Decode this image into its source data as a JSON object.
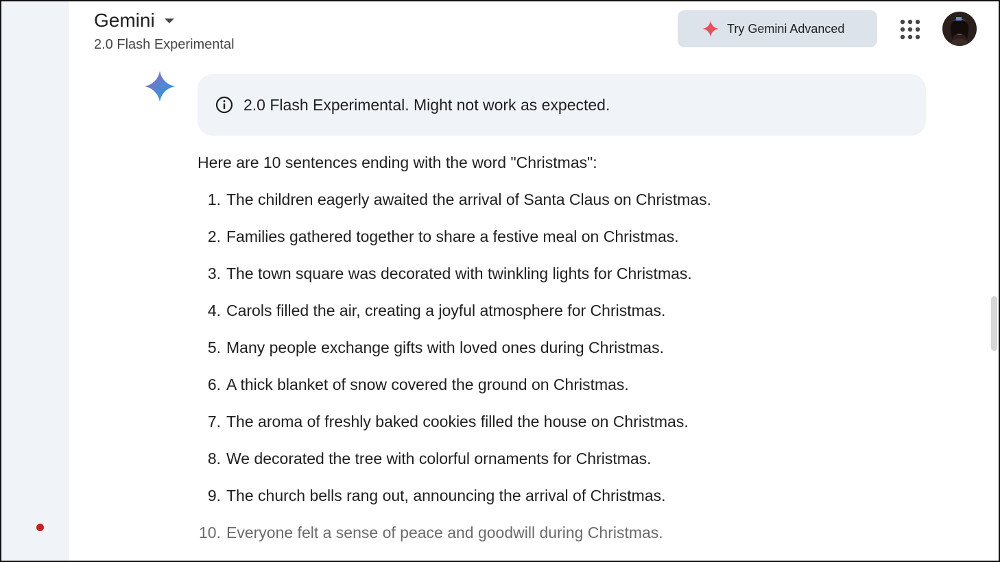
{
  "header": {
    "app_name": "Gemini",
    "model": "2.0 Flash Experimental",
    "advanced_button": "Try Gemini Advanced"
  },
  "notice": {
    "text": "2.0 Flash Experimental. Might not work as expected."
  },
  "response": {
    "intro": "Here are 10 sentences ending with the word \"Christmas\":",
    "items": [
      {
        "num": "1.",
        "text": "The children eagerly awaited the arrival of Santa Claus on Christmas."
      },
      {
        "num": "2.",
        "text": "Families gathered together to share a festive meal on Christmas."
      },
      {
        "num": "3.",
        "text": "The town square was decorated with twinkling lights for Christmas."
      },
      {
        "num": "4.",
        "text": "Carols filled the air, creating a joyful atmosphere for Christmas."
      },
      {
        "num": "5.",
        "text": "Many people exchange gifts with loved ones during Christmas."
      },
      {
        "num": "6.",
        "text": "A thick blanket of snow covered the ground on Christmas."
      },
      {
        "num": "7.",
        "text": "The aroma of freshly baked cookies filled the house on Christmas."
      },
      {
        "num": "8.",
        "text": "We decorated the tree with colorful ornaments for Christmas."
      },
      {
        "num": "9.",
        "text": "The church bells rang out, announcing the arrival of Christmas."
      },
      {
        "num": "10.",
        "text": "Everyone felt a sense of peace and goodwill during Christmas."
      }
    ]
  },
  "icons": {
    "caret": "chevron-down-icon",
    "advanced": "sparkle-icon",
    "apps": "apps-grid-icon",
    "notice": "info-icon",
    "logo": "gemini-sparkle-icon"
  },
  "colors": {
    "sidebar_bg": "#f0f4f9",
    "notice_bg": "#f0f4f9",
    "button_bg": "#dde3ea",
    "sparkle_red": "#e8505b",
    "recording_dot": "#c5221f"
  }
}
